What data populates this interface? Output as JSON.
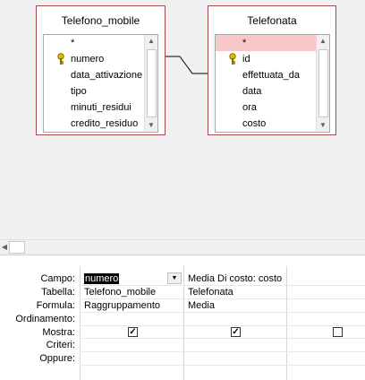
{
  "tables": [
    {
      "title": "Telefono_mobile",
      "fields": [
        {
          "name": "*",
          "key": false,
          "selected": false
        },
        {
          "name": "numero",
          "key": true,
          "selected": false
        },
        {
          "name": "data_attivazione",
          "key": false,
          "selected": false
        },
        {
          "name": "tipo",
          "key": false,
          "selected": false
        },
        {
          "name": "minuti_residui",
          "key": false,
          "selected": false
        },
        {
          "name": "credito_residuo",
          "key": false,
          "selected": false
        }
      ]
    },
    {
      "title": "Telefonata",
      "fields": [
        {
          "name": "*",
          "key": false,
          "selected": true
        },
        {
          "name": "id",
          "key": true,
          "selected": false
        },
        {
          "name": "effettuata_da",
          "key": false,
          "selected": false
        },
        {
          "name": "data",
          "key": false,
          "selected": false
        },
        {
          "name": "ora",
          "key": false,
          "selected": false
        },
        {
          "name": "costo",
          "key": false,
          "selected": false
        }
      ]
    }
  ],
  "grid": {
    "row_labels": {
      "campo": "Campo:",
      "tabella": "Tabella:",
      "formula": "Formula:",
      "ordinamento": "Ordinamento:",
      "mostra": "Mostra:",
      "criteri": "Criteri:",
      "oppure": "Oppure:"
    },
    "columns": [
      {
        "campo": "numero",
        "tabella": "Telefono_mobile",
        "formula": "Raggruppamento",
        "ordinamento": "",
        "mostra": true,
        "criteri": "",
        "oppure": ""
      },
      {
        "campo": "Media Di costo: costo",
        "tabella": "Telefonata",
        "formula": "Media",
        "ordinamento": "",
        "mostra": true,
        "criteri": "",
        "oppure": ""
      },
      {
        "campo": "",
        "tabella": "",
        "formula": "",
        "ordinamento": "",
        "mostra": false,
        "criteri": "",
        "oppure": ""
      }
    ]
  },
  "icons": {
    "key": "primary-key-icon",
    "scroll_up": "scroll-up-arrow-icon",
    "scroll_down": "scroll-down-arrow-icon",
    "scroll_left": "scroll-left-arrow-icon",
    "dropdown": "dropdown-arrow-icon",
    "check": "checkmark-icon"
  },
  "colors": {
    "table_border": "#a24b4b",
    "selected_field": "#f8c6c6",
    "design_background": "#f0f0f2"
  }
}
